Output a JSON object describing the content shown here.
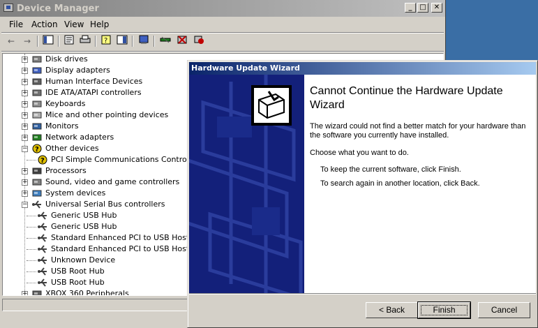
{
  "device_manager": {
    "title": "Device Manager",
    "window_buttons": {
      "minimize": "_",
      "maximize": "□",
      "close": "✕"
    },
    "menu": [
      "File",
      "Action",
      "View",
      "Help"
    ],
    "tree": [
      {
        "label": "Disk drives",
        "icon": "disk-drive-icon",
        "color": "#808080",
        "indent": 0,
        "expander": "+"
      },
      {
        "label": "Display adapters",
        "icon": "display-adapter-icon",
        "color": "#4060c0",
        "indent": 0,
        "expander": "+"
      },
      {
        "label": "Human Interface Devices",
        "icon": "hid-icon",
        "color": "#606060",
        "indent": 0,
        "expander": "+"
      },
      {
        "label": "IDE ATA/ATAPI controllers",
        "icon": "ide-controller-icon",
        "color": "#707070",
        "indent": 0,
        "expander": "+"
      },
      {
        "label": "Keyboards",
        "icon": "keyboard-icon",
        "color": "#909090",
        "indent": 0,
        "expander": "+"
      },
      {
        "label": "Mice and other pointing devices",
        "icon": "mouse-icon",
        "color": "#b0b0b0",
        "indent": 0,
        "expander": "+"
      },
      {
        "label": "Monitors",
        "icon": "monitor-icon",
        "color": "#3060a0",
        "indent": 0,
        "expander": "+"
      },
      {
        "label": "Network adapters",
        "icon": "network-adapter-icon",
        "color": "#208020",
        "indent": 0,
        "expander": "+"
      },
      {
        "label": "Other devices",
        "icon": "unknown-device-icon",
        "color": "#e0c000",
        "indent": 0,
        "expander": "−"
      },
      {
        "label": "PCI Simple Communications Controller",
        "icon": "warning-device-icon",
        "color": "#e0c000",
        "indent": 1,
        "expander": ""
      },
      {
        "label": "Processors",
        "icon": "processor-icon",
        "color": "#404040",
        "indent": 0,
        "expander": "+"
      },
      {
        "label": "Sound, video and game controllers",
        "icon": "sound-icon",
        "color": "#808080",
        "indent": 0,
        "expander": "+"
      },
      {
        "label": "System devices",
        "icon": "system-device-icon",
        "color": "#4080c0",
        "indent": 0,
        "expander": "+"
      },
      {
        "label": "Universal Serial Bus controllers",
        "icon": "usb-icon",
        "color": "#404040",
        "indent": 0,
        "expander": "−"
      },
      {
        "label": "Generic USB Hub",
        "icon": "usb-icon",
        "color": "#404040",
        "indent": 1,
        "expander": ""
      },
      {
        "label": "Generic USB Hub",
        "icon": "usb-icon",
        "color": "#404040",
        "indent": 1,
        "expander": ""
      },
      {
        "label": "Standard Enhanced PCI to USB Host Controller",
        "icon": "usb-icon",
        "color": "#404040",
        "indent": 1,
        "expander": ""
      },
      {
        "label": "Standard Enhanced PCI to USB Host Controller",
        "icon": "usb-icon",
        "color": "#404040",
        "indent": 1,
        "expander": ""
      },
      {
        "label": "Unknown Device",
        "icon": "usb-icon",
        "color": "#404040",
        "indent": 1,
        "expander": ""
      },
      {
        "label": "USB Root Hub",
        "icon": "usb-icon",
        "color": "#404040",
        "indent": 1,
        "expander": ""
      },
      {
        "label": "USB Root Hub",
        "icon": "usb-icon",
        "color": "#404040",
        "indent": 1,
        "expander": ""
      },
      {
        "label": "XBOX 360 Peripherals",
        "icon": "xbox-icon",
        "color": "#606060",
        "indent": 0,
        "expander": "+"
      }
    ]
  },
  "wizard": {
    "title": "Hardware Update Wizard",
    "heading": "Cannot Continue the Hardware Update Wizard",
    "message": "The wizard could not find a better match for your hardware than the software you currently have installed.",
    "prompt": "Choose what you want to do.",
    "option_finish": "To keep the current software, click Finish.",
    "option_back": "To search again in another location, click Back.",
    "buttons": {
      "back": "< Back",
      "finish": "Finish",
      "cancel": "Cancel"
    },
    "banner_color": "#13207a"
  },
  "colors": {
    "desktop": "#3a6ea5",
    "face": "#d4d0c8",
    "active_title": "#0a246a"
  }
}
